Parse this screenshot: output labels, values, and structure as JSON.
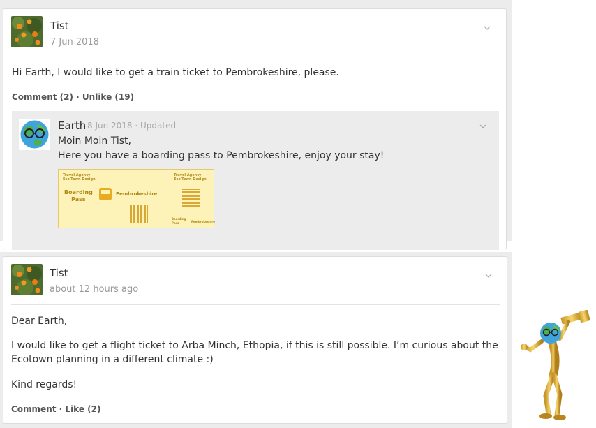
{
  "post1": {
    "author": "Tist",
    "date": "7 Jun 2018",
    "text": "Hi Earth, I would like to get a train ticket to Pembrokeshire, please.",
    "comment_label": "Comment (2)",
    "separator": "·",
    "like_label": "Unlike (19)",
    "reply": {
      "author": "Earth",
      "date": "8 Jun 2018",
      "updated": "· Updated",
      "line1": "Moin Moin Tist,",
      "line2": "Here you have a boarding pass to Pembrokeshire, enjoy your stay!",
      "ticket": {
        "agency1": "Travel Agency",
        "agency2": "Eco-Town Design",
        "title1": "Boarding",
        "title2": "Pass",
        "destination": "Pembrokeshire",
        "stub_agency1": "Travel Agency",
        "stub_agency2": "Eco-Town Design",
        "stub_title": "Boarding Pass",
        "stub_dest": "Pembrokeshire"
      }
    }
  },
  "post2": {
    "author": "Tist",
    "date": "about 12 hours ago",
    "greeting": "Dear Earth,",
    "para1_line1": "I would like to get a flight ticket to Arba Minch, Ethopia, if this is still possible. I’m curious about the",
    "para1_line2": "Ecotown planning in a different climate :)",
    "closing": "Kind regards!",
    "comment_label": "Comment",
    "separator": "·",
    "like_label": "Like (2)"
  },
  "icons": {
    "chevron": "chevron-down-icon",
    "avatar_tist": "orange-tree-avatar",
    "avatar_earth": "earth-with-glasses-avatar",
    "mascot": "golden-figure-with-telescope"
  },
  "colors": {
    "ticket_bg": "#fdf2b8",
    "ticket_text": "#b08a18",
    "panel_bg": "#ececec"
  }
}
